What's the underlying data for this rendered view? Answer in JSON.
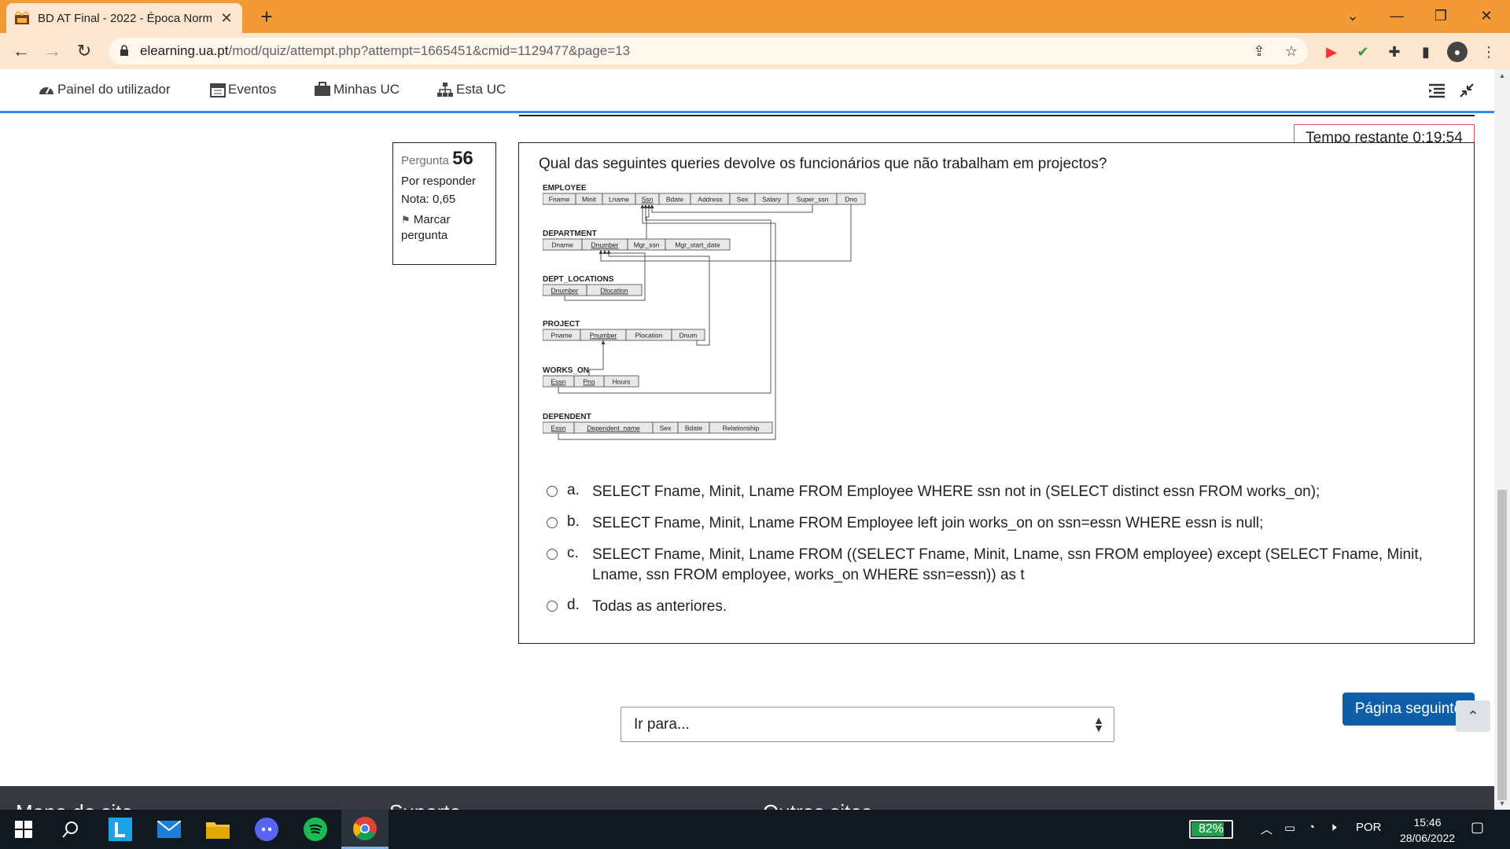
{
  "browser": {
    "tab_title": "BD AT Final - 2022 - Época Norm",
    "url_host": "elearning.ua.pt",
    "url_path": "/mod/quiz/attempt.php?attempt=1665451&cmid=1129477&page=13"
  },
  "sitenav": {
    "items": [
      {
        "label": "Painel do utilizador"
      },
      {
        "label": "Eventos"
      },
      {
        "label": "Minhas UC"
      },
      {
        "label": "Esta UC"
      }
    ]
  },
  "timer": "Tempo restante 0:19:54",
  "question": {
    "label": "Pergunta",
    "number": "56",
    "status": "Por responder",
    "grade": "Nota: 0,65",
    "flag_label": "Marcar pergunta",
    "text": "Qual das seguintes queries devolve os funcionários que não trabalham em projectos?",
    "schema": {
      "tables": [
        {
          "name": "EMPLOYEE",
          "columns": [
            "Fname",
            "Minit",
            "Lname",
            "Ssn",
            "Bdate",
            "Address",
            "Sex",
            "Salary",
            "Super_ssn",
            "Dno"
          ]
        },
        {
          "name": "DEPARTMENT",
          "columns": [
            "Dname",
            "Dnumber",
            "Mgr_ssn",
            "Mgr_start_date"
          ]
        },
        {
          "name": "DEPT_LOCATIONS",
          "columns": [
            "Dnumber",
            "Dlocation"
          ]
        },
        {
          "name": "PROJECT",
          "columns": [
            "Pname",
            "Pnumber",
            "Plocation",
            "Dnum"
          ]
        },
        {
          "name": "WORKS_ON",
          "columns": [
            "Essn",
            "Pno",
            "Hours"
          ]
        },
        {
          "name": "DEPENDENT",
          "columns": [
            "Essn",
            "Dependent_name",
            "Sex",
            "Bdate",
            "Relationship"
          ]
        }
      ]
    },
    "answers": [
      {
        "letter": "a.",
        "text": "SELECT Fname, Minit, Lname FROM Employee WHERE ssn not in (SELECT distinct essn FROM works_on);",
        "selected": false
      },
      {
        "letter": "b.",
        "text": "SELECT Fname, Minit, Lname FROM Employee left join works_on on ssn=essn WHERE essn is null;",
        "selected": false
      },
      {
        "letter": "c.",
        "text": "SELECT Fname, Minit, Lname FROM ((SELECT Fname, Minit, Lname, ssn FROM employee) except (SELECT Fname, Minit, Lname, ssn FROM employee, works_on WHERE ssn=essn)) as t",
        "selected": false
      },
      {
        "letter": "d.",
        "text": "Todas as anteriores.",
        "selected": false
      }
    ]
  },
  "next_button": "Página seguinte",
  "jump_select": {
    "selected": "Ir para..."
  },
  "footer": {
    "headings": [
      "Mapa do site",
      "Suporte",
      "Outros sites"
    ]
  },
  "taskbar": {
    "battery": "82%",
    "language": "POR",
    "time": "15:46",
    "date": "28/06/2022"
  },
  "colors": {
    "titlebar": "#f39a36",
    "tab": "#fde6cf",
    "button": "#0f5ea8",
    "timer_border": "#d9534f"
  }
}
